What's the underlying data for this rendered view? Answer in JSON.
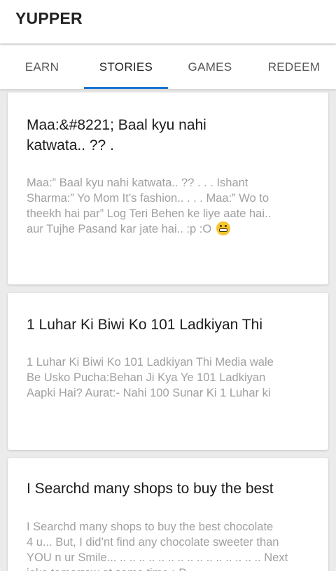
{
  "app": {
    "title": "YUPPER",
    "accent_color": "#1976d2"
  },
  "tabs": [
    {
      "label": "EARN",
      "active": false
    },
    {
      "label": "STORIES",
      "active": true
    },
    {
      "label": "GAMES",
      "active": false
    },
    {
      "label": "REDEEM",
      "active": false
    }
  ],
  "stories": [
    {
      "title_line1": "Maa:&#8221; Baal kyu nahi",
      "title_line2": "katwata.. ?? .",
      "body_line1": "Maa:” Baal kyu nahi katwata.. ?? . . . Ishant",
      "body_line2": "Sharma:” Yo Mom It’s fashion.. . . . Maa:” Wo to",
      "body_line3": "theekh hai par” Log Teri Behen ke liye aate hai..",
      "body_line4": "aur Tujhe Pasand kar jate hai.. :p :O",
      "emoji": "grimacing-face-icon"
    },
    {
      "title_line1": "1 Luhar Ki Biwi Ko 101 Ladkiyan Thi",
      "body_line1": "1 Luhar Ki Biwi Ko 101 Ladkiyan Thi Media wale",
      "body_line2": "Be Usko Pucha:Behan Ji Kya Ye 101 Ladkiyan",
      "body_line3": "Aapki Hai? Aurat:- Nahi 100 Sunar Ki 1 Luhar ki"
    },
    {
      "title_line1": "I Searchd many shops to buy the best",
      "body_line1": "I Searchd many shops to buy the best chocolate",
      "body_line2": "4 u... But, I did’nt find any chocolate sweeter than",
      "body_line3": "YOU n ur Smile... .. .. .. .. .. .. .. .. .. .. .. .. .. .. .. Next",
      "body_line4": "joke tomorrow at same time :-P"
    }
  ]
}
